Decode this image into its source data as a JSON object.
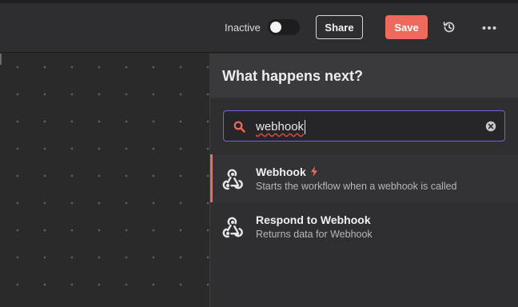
{
  "header": {
    "status_label": "Inactive",
    "active": false,
    "share_label": "Share",
    "save_label": "Save",
    "history_icon": "history-icon",
    "more_icon": "ellipsis-horizontal-icon"
  },
  "panel": {
    "title": "What happens next?",
    "search": {
      "value": "webhook",
      "icon": "search-icon",
      "clear_icon": "clear-circle-icon"
    },
    "results": [
      {
        "title": "Webhook",
        "description": "Starts the workflow when a webhook is called",
        "icon": "webhook-icon",
        "trigger_badge_icon": "bolt-icon",
        "selected": true
      },
      {
        "title": "Respond to Webhook",
        "description": "Returns data for Webhook",
        "icon": "webhook-icon",
        "selected": false
      }
    ]
  },
  "colors": {
    "accent": "#ee6a5c",
    "focus_border": "#7a5ce6",
    "background": "#2a2a2b",
    "panel": "#2f2f31"
  }
}
